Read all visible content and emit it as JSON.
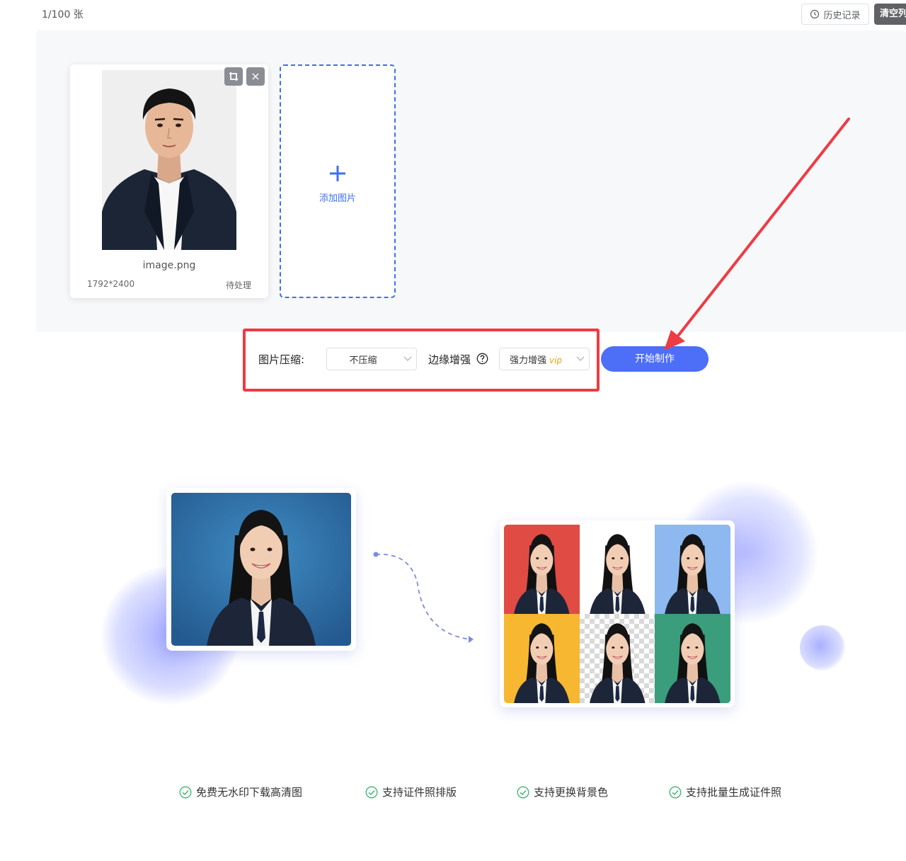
{
  "header": {
    "count": "1/100 张",
    "history_label": "历史记录",
    "history_icon": "clock-icon",
    "clear_label": "清空列"
  },
  "files": [
    {
      "name": "image.png",
      "dimensions": "1792*2400",
      "status": "待处理"
    }
  ],
  "add_image": {
    "label": "添加图片",
    "icon": "plus-icon"
  },
  "options": {
    "compress_label": "图片压缩:",
    "compress_value": "不压缩",
    "edge_label": "边缘增强",
    "edge_value": "强力增强",
    "edge_badge": "vip",
    "help_icon": "question-circle-icon"
  },
  "start_button": "开始制作",
  "features": [
    "免费无水印下载高清图",
    "支持证件照排版",
    "支持更换背景色",
    "支持批量生成证件照"
  ],
  "colors": {
    "primary": "#4d6ef7",
    "annotation_red": "#ee3b44",
    "vip": "#e8a31a",
    "success": "#3bb56b",
    "bg_red": "#e04b44",
    "bg_white": "#ffffff",
    "bg_lightblue": "#8db8f0",
    "bg_yellow": "#f7b731",
    "bg_green": "#3a9d7c",
    "bg_sourceblue": "#2f74b0"
  }
}
